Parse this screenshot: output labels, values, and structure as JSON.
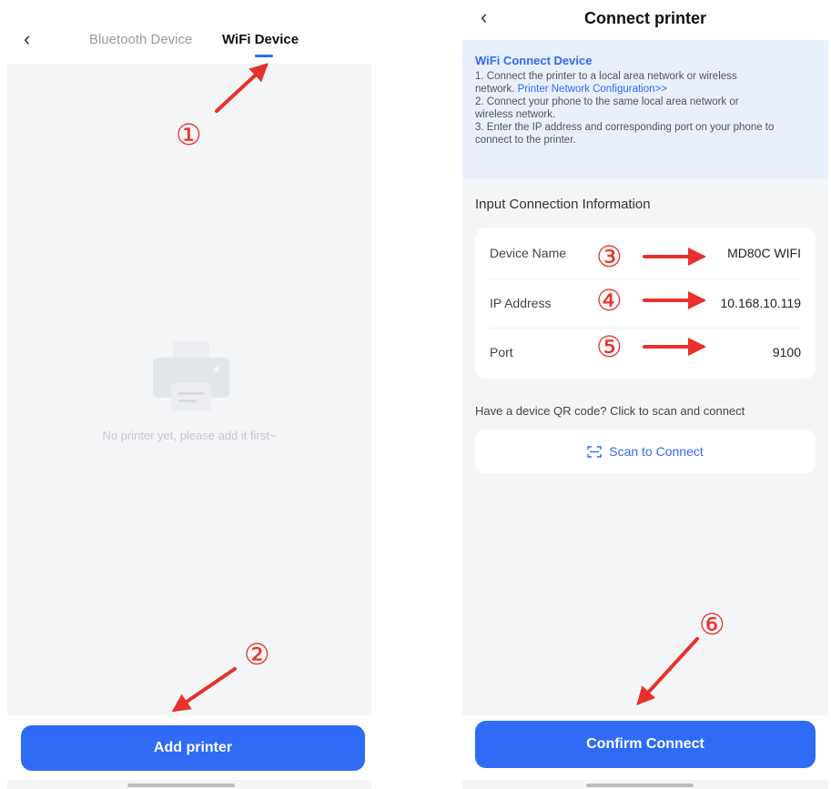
{
  "left_screen": {
    "back_icon": "‹",
    "tabs": [
      {
        "label": "Bluetooth Device",
        "active": false
      },
      {
        "label": "WiFi Device",
        "active": true
      }
    ],
    "empty_state": {
      "icon": "printer-icon",
      "text": "No printer yet, please add it first~"
    },
    "add_button": "Add printer"
  },
  "right_screen": {
    "back_icon": "‹",
    "title": "Connect printer",
    "info": {
      "title": "WiFi Connect Device",
      "line1": "1. Connect the printer to a local area network or wireless",
      "line2_prefix": "network.",
      "link": "Printer Network Configuration>>",
      "line3": "2. Connect your phone to the same local area network or",
      "line4": "wireless network.",
      "line5": "3. Enter the IP address and corresponding port on your phone to",
      "line6": "connect to the printer."
    },
    "section_title": "Input Connection Information",
    "fields": [
      {
        "label": "Device Name",
        "value": "MD80C WIFI"
      },
      {
        "label": "IP Address",
        "value": "10.168.10.119"
      },
      {
        "label": "Port",
        "value": "9100"
      }
    ],
    "qr_hint": "Have a device QR code? Click to scan and connect",
    "scan_button": "Scan to Connect",
    "confirm_button": "Confirm Connect"
  },
  "annotations": {
    "markers": [
      "①",
      "②",
      "③",
      "④",
      "⑤",
      "⑥"
    ],
    "color": "#e8312b"
  },
  "colors": {
    "accent": "#2f6bf5",
    "page_bg": "#f4f5f7",
    "info_bg": "#e7f0fb"
  }
}
